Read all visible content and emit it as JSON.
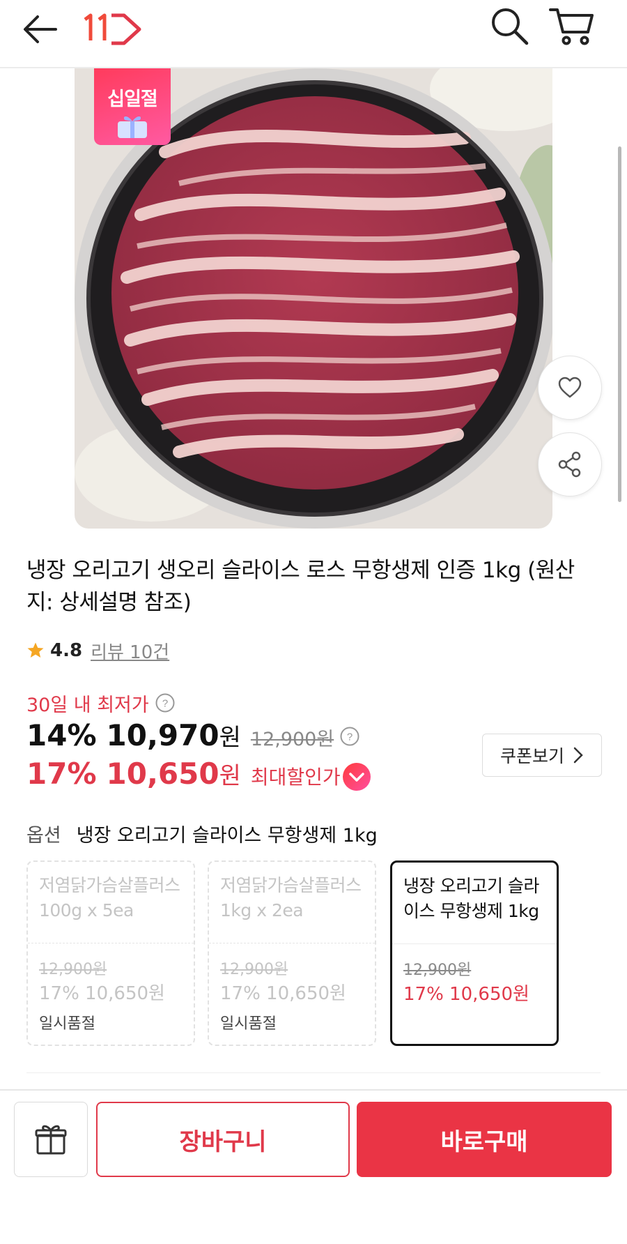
{
  "header": {
    "logo": "11",
    "icons": [
      "back-arrow-icon",
      "logo-icon",
      "search-icon",
      "cart-icon"
    ],
    "brand_color": "#e0394a"
  },
  "image": {
    "badge_text": "십일절",
    "alt": "product-photo"
  },
  "actions": {
    "heart": "heart-icon",
    "share": "share-icon"
  },
  "product": {
    "title": "냉장 오리고기 생오리 슬라이스 로스 무항생제 인증 1kg (원산지: 상세설명 참조)",
    "rating": "4.8",
    "review_link": "리뷰 10건"
  },
  "pricing": {
    "lowest_label": "30일 내 최저가",
    "discount1": "14%",
    "price1": "10,970",
    "won1": "원",
    "original": "12,900원",
    "discount2": "17%",
    "price2": "10,650",
    "won2": "원",
    "max_label": "최대할인가",
    "coupon_button": "쿠폰보기"
  },
  "options": {
    "key": "옵션",
    "selected_value": "냉장 오리고기 슬라이스 무항생제 1kg",
    "cards": [
      {
        "name": "저염닭가슴살플러스 100g x 5ea",
        "orig": "12,900원",
        "sale": "17% 10,650원",
        "status": "일시품절"
      },
      {
        "name": "저염닭가슴살플러스 1kg x 2ea",
        "orig": "12,900원",
        "sale": "17% 10,650원",
        "status": "일시품절"
      },
      {
        "name": "냉장 오리고기 슬라이스 무항생제 1kg",
        "orig": "12,900원",
        "sale": "17% 10,650원",
        "status": ""
      }
    ]
  },
  "bottom_bar": {
    "cart_label": "장바구니",
    "buy_label": "바로구매",
    "gift_icon": "gift-icon"
  }
}
